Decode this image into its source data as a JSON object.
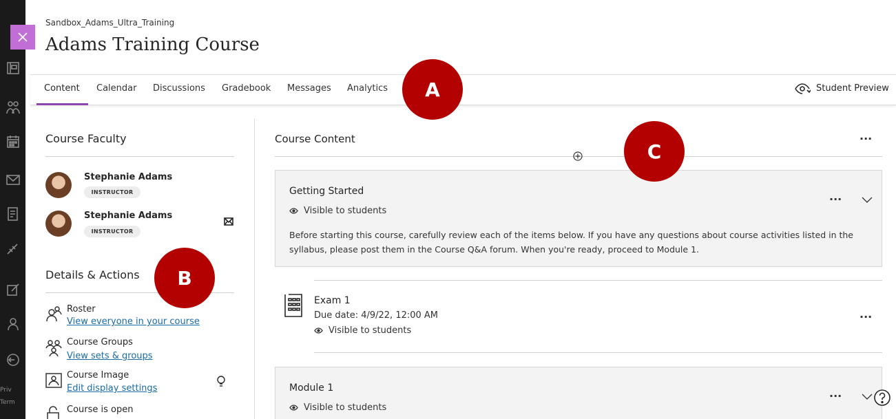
{
  "header": {
    "breadcrumb": "Sandbox_Adams_Ultra_Training",
    "title": "Adams Training Course"
  },
  "rail": {
    "footer_lines": [
      "Priv",
      "Term"
    ]
  },
  "tabs": [
    {
      "label": "Content",
      "active": true
    },
    {
      "label": "Calendar"
    },
    {
      "label": "Discussions"
    },
    {
      "label": "Gradebook"
    },
    {
      "label": "Messages"
    },
    {
      "label": "Analytics"
    }
  ],
  "student_preview_label": "Student Preview",
  "markers": {
    "a": "A",
    "b": "B",
    "c": "C"
  },
  "faculty": {
    "heading": "Course Faculty",
    "members": [
      {
        "name": "Stephanie Adams",
        "role": "INSTRUCTOR"
      },
      {
        "name": "Stephanie Adams",
        "role": "INSTRUCTOR"
      }
    ]
  },
  "details": {
    "heading": "Details & Actions",
    "items": [
      {
        "title": "Roster",
        "link": "View everyone in your course",
        "icon": "roster-icon"
      },
      {
        "title": "Course Groups",
        "link": "View sets & groups",
        "icon": "groups-icon"
      },
      {
        "title": "Course Image",
        "link": "Edit display settings",
        "icon": "image-icon"
      },
      {
        "title": "Course is open",
        "icon": "lock-open-icon"
      }
    ]
  },
  "content": {
    "heading": "Course Content",
    "items": [
      {
        "title": "Getting Started",
        "visibility": "Visible to students",
        "description": "Before starting this course, carefully review each of the items below. If you have any questions about course activities listed in the syllabus, please post them in the Course Q&A forum. When you're ready, proceed to Module 1."
      },
      {
        "title": "Exam 1",
        "due": "Due date: 4/9/22, 12:00 AM",
        "visibility": "Visible to students"
      },
      {
        "title": "Module 1",
        "visibility": "Visible to students"
      }
    ]
  },
  "colors": {
    "accent": "#8e44ad",
    "close_button": "#c16fd6",
    "marker": "#b30000",
    "link": "#1a6ca6",
    "rail": "#1a1a1a"
  }
}
